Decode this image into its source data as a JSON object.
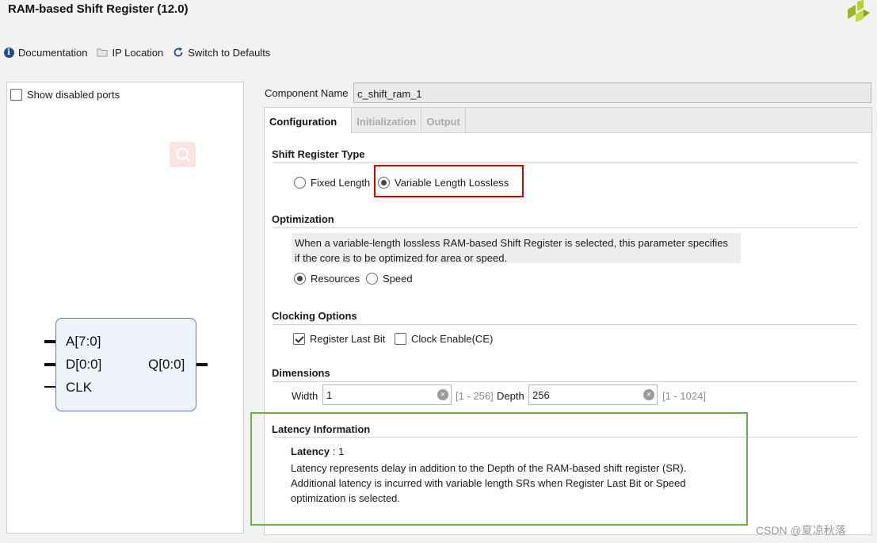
{
  "window": {
    "title": "RAM-based Shift Register (12.0)"
  },
  "toolbar": {
    "documentation": "Documentation",
    "ip_location": "IP Location",
    "switch_defaults": "Switch to Defaults"
  },
  "left_panel": {
    "show_disabled_ports": "Show disabled ports",
    "symbol": {
      "inputs": [
        "A[7:0]",
        "D[0:0]",
        "CLK"
      ],
      "outputs": [
        "Q[0:0]"
      ]
    }
  },
  "component_name": {
    "label": "Component Name",
    "value": "c_shift_ram_1"
  },
  "tabs": [
    "Configuration",
    "Initialization",
    "Output"
  ],
  "shift_register_type": {
    "title": "Shift Register Type",
    "options": [
      "Fixed Length",
      "Variable Length Lossless"
    ],
    "selected": "Variable Length Lossless"
  },
  "optimization": {
    "title": "Optimization",
    "description_line1": "When a variable-length lossless RAM-based Shift Register is selected, this parameter specifies",
    "description_line2": "if the core is to be optimized for area or speed.",
    "options": [
      "Resources",
      "Speed"
    ],
    "selected": "Resources"
  },
  "clocking": {
    "title": "Clocking Options",
    "register_last_bit": "Register Last Bit",
    "register_last_bit_checked": true,
    "clock_enable": "Clock Enable(CE)",
    "clock_enable_checked": false
  },
  "dimensions": {
    "title": "Dimensions",
    "width_label": "Width",
    "width_value": "1",
    "width_range": "[1 - 256]",
    "depth_label": "Depth",
    "depth_value": "256",
    "depth_range": "[1 - 1024]"
  },
  "latency": {
    "title": "Latency Information",
    "label": "Latency",
    "value": " : 1",
    "line1": "Latency represents delay in addition to the Depth of the RAM-based shift register (SR).",
    "line2": "Additional latency is incurred with variable length SRs when Register Last Bit or Speed",
    "line3": "optimization is selected."
  },
  "watermark": "CSDN @夏凉秋落",
  "colors": {
    "red_highlight": "#d00000",
    "green_highlight": "#6fad47",
    "accent_blue": "#1f4e99"
  }
}
